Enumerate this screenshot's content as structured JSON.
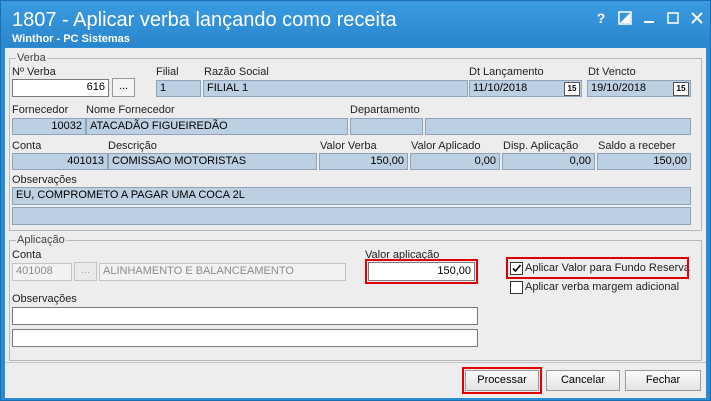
{
  "window": {
    "title": "1807 - Aplicar verba lançando como receita",
    "subtitle": "Winthor - PC Sistemas",
    "help_icon": "?",
    "colors": {
      "titlebar": "#2b8bd4",
      "highlight": "#e00000",
      "field": "#bcd0e2"
    }
  },
  "verba": {
    "group_label": "Verba",
    "nverba_label": "Nº Verba",
    "nverba_value": "616",
    "filial_label": "Filial",
    "filial_value": "1",
    "razao_label": "Razão Social",
    "razao_value": "FILIAL 1",
    "dt_lanc_label": "Dt Lançamento",
    "dt_lanc_value": "11/10/2018",
    "dt_venc_label": "Dt Vencto",
    "dt_venc_value": "19/10/2018",
    "cal_icon": "15",
    "fornecedor_label": "Fornecedor",
    "fornecedor_value": "10032",
    "nome_fornecedor_label": "Nome Fornecedor",
    "nome_fornecedor_value": "ATACADÃO FIGUEIREDÃO",
    "departamento_label": "Departamento",
    "departamento_value": "",
    "conta_label": "Conta",
    "conta_value": "401013",
    "descricao_label": "Descrição",
    "descricao_value": "COMISSAO MOTORISTAS",
    "valor_verba_label": "Valor Verba",
    "valor_verba_value": "150,00",
    "valor_aplicado_label": "Valor Aplicado",
    "valor_aplicado_value": "0,00",
    "disp_aplicacao_label": "Disp. Aplicação",
    "disp_aplicacao_value": "0,00",
    "saldo_label": "Saldo a receber",
    "saldo_value": "150,00",
    "obs_label": "Observações",
    "obs_line1": "EU, COMPROMETO A PAGAR UMA COCA 2L",
    "obs_line2": ""
  },
  "aplicacao": {
    "group_label": "Aplicação",
    "conta_label": "Conta",
    "conta_value": "401008",
    "conta_desc": "ALINHAMENTO E BALANCEAMENTO",
    "valor_label": "Valor aplicação",
    "valor_value": "150,00",
    "chk_fundo_label": "Aplicar Valor para Fundo Reserva",
    "chk_fundo_checked": true,
    "chk_margem_label": "Aplicar verba margem adicional",
    "chk_margem_checked": false,
    "obs_label": "Observações",
    "obs_line1": "",
    "obs_line2": ""
  },
  "buttons": {
    "dots": "...",
    "processar": "Processar",
    "cancelar": "Cancelar",
    "fechar": "Fechar"
  }
}
